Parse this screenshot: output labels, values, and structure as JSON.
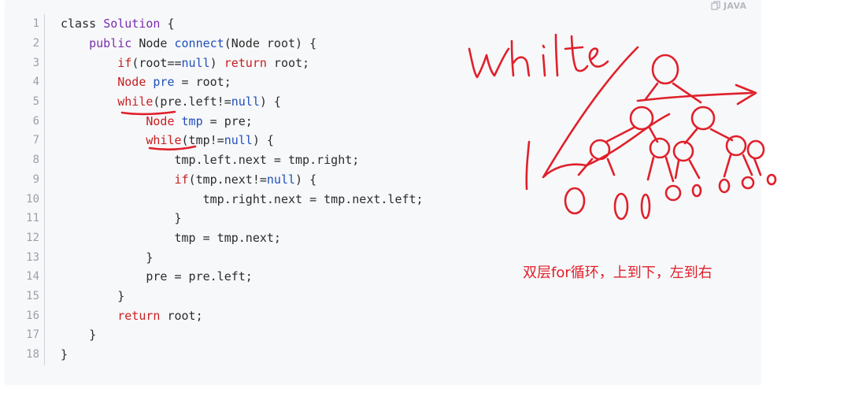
{
  "language_badge": "JAVA",
  "code_lines": [
    {
      "n": "1",
      "tokens": [
        {
          "t": "class ",
          "c": "plain"
        },
        {
          "t": "Solution",
          "c": "ty"
        },
        {
          "t": " {",
          "c": "plain"
        }
      ]
    },
    {
      "n": "2",
      "tokens": [
        {
          "t": "    ",
          "c": "plain"
        },
        {
          "t": "public",
          "c": "kwp"
        },
        {
          "t": " Node ",
          "c": "plain"
        },
        {
          "t": "connect",
          "c": "fn"
        },
        {
          "t": "(Node root) {",
          "c": "plain"
        }
      ]
    },
    {
      "n": "3",
      "tokens": [
        {
          "t": "        ",
          "c": "plain"
        },
        {
          "t": "if",
          "c": "kw"
        },
        {
          "t": "(root==",
          "c": "plain"
        },
        {
          "t": "null",
          "c": "lit"
        },
        {
          "t": ") ",
          "c": "plain"
        },
        {
          "t": "return",
          "c": "kw"
        },
        {
          "t": " root;",
          "c": "plain"
        }
      ]
    },
    {
      "n": "4",
      "tokens": [
        {
          "t": "        ",
          "c": "plain"
        },
        {
          "t": "Node",
          "c": "kw"
        },
        {
          "t": " ",
          "c": "plain"
        },
        {
          "t": "pre",
          "c": "fn"
        },
        {
          "t": " = root;",
          "c": "plain"
        }
      ]
    },
    {
      "n": "5",
      "tokens": [
        {
          "t": "        ",
          "c": "plain"
        },
        {
          "t": "while",
          "c": "kw"
        },
        {
          "t": "(pre.left!=",
          "c": "plain"
        },
        {
          "t": "null",
          "c": "lit"
        },
        {
          "t": ") {",
          "c": "plain"
        }
      ]
    },
    {
      "n": "6",
      "tokens": [
        {
          "t": "            ",
          "c": "plain"
        },
        {
          "t": "Node",
          "c": "kw"
        },
        {
          "t": " ",
          "c": "plain"
        },
        {
          "t": "tmp",
          "c": "fn"
        },
        {
          "t": " = pre;",
          "c": "plain"
        }
      ]
    },
    {
      "n": "7",
      "tokens": [
        {
          "t": "            ",
          "c": "plain"
        },
        {
          "t": "while",
          "c": "kw"
        },
        {
          "t": "(tmp!=",
          "c": "plain"
        },
        {
          "t": "null",
          "c": "lit"
        },
        {
          "t": ") {",
          "c": "plain"
        }
      ]
    },
    {
      "n": "8",
      "tokens": [
        {
          "t": "                tmp.left.next = tmp.right;",
          "c": "plain"
        }
      ]
    },
    {
      "n": "9",
      "tokens": [
        {
          "t": "                ",
          "c": "plain"
        },
        {
          "t": "if",
          "c": "kw"
        },
        {
          "t": "(tmp.next!=",
          "c": "plain"
        },
        {
          "t": "null",
          "c": "lit"
        },
        {
          "t": ") {",
          "c": "plain"
        }
      ]
    },
    {
      "n": "10",
      "tokens": [
        {
          "t": "                    tmp.right.next = tmp.next.left;",
          "c": "plain"
        }
      ]
    },
    {
      "n": "11",
      "tokens": [
        {
          "t": "                }",
          "c": "plain"
        }
      ]
    },
    {
      "n": "12",
      "tokens": [
        {
          "t": "                tmp = tmp.next;",
          "c": "plain"
        }
      ]
    },
    {
      "n": "13",
      "tokens": [
        {
          "t": "            }",
          "c": "plain"
        }
      ]
    },
    {
      "n": "14",
      "tokens": [
        {
          "t": "            pre = pre.left;",
          "c": "plain"
        }
      ]
    },
    {
      "n": "15",
      "tokens": [
        {
          "t": "        }",
          "c": "plain"
        }
      ]
    },
    {
      "n": "16",
      "tokens": [
        {
          "t": "        ",
          "c": "plain"
        },
        {
          "t": "return",
          "c": "kw"
        },
        {
          "t": " root;",
          "c": "plain"
        }
      ]
    },
    {
      "n": "17",
      "tokens": [
        {
          "t": "    }",
          "c": "plain"
        }
      ]
    },
    {
      "n": "18",
      "tokens": [
        {
          "t": "}",
          "c": "plain"
        }
      ]
    }
  ],
  "annotations": {
    "handwritten_word": "while",
    "note": "双层for循环，上到下，左到右",
    "ink_color": "#e0202a"
  }
}
